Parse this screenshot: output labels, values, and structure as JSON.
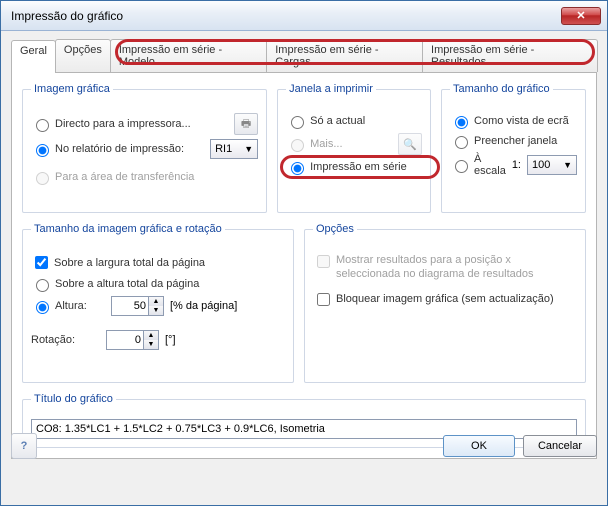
{
  "window": {
    "title": "Impressão do gráfico"
  },
  "tabs": {
    "geral": "Geral",
    "opcoes": "Opções",
    "serie_modelo": "Impressão em série - Modelo",
    "serie_cargas": "Impressão em série - Cargas",
    "serie_resultados": "Impressão em série - Resultados"
  },
  "group_imagem": {
    "legend": "Imagem gráfica",
    "directo": "Directo para a impressora...",
    "relatorio": "No relatório de impressão:",
    "relatorio_val": "RI1",
    "clipboard": "Para a área de transferência"
  },
  "group_janela": {
    "legend": "Janela a imprimir",
    "so_actual": "Só a actual",
    "mais": "Mais...",
    "serie": "Impressão em série"
  },
  "group_tamanho": {
    "legend": "Tamanho do gráfico",
    "como_vista": "Como vista de ecrã",
    "preencher": "Preencher janela",
    "escala": "À escala",
    "escala_prefix": "1:",
    "escala_val": "100"
  },
  "group_rotacao": {
    "legend": "Tamanho da imagem gráfica e rotação",
    "largura_total": "Sobre a largura total da página",
    "altura_total": "Sobre a altura total da página",
    "altura_label": "Altura:",
    "altura_val": "50",
    "altura_unit": "[% da página]",
    "rotacao_label": "Rotação:",
    "rotacao_val": "0",
    "rotacao_unit": "[°]"
  },
  "group_opcoes": {
    "legend": "Opções",
    "mostrar": "Mostrar resultados para a posição x seleccionada no diagrama de resultados",
    "bloquear": "Bloquear imagem gráfica (sem actualização)"
  },
  "group_titulo": {
    "legend": "Título do gráfico",
    "value": "CO8: 1.35*LC1 + 1.5*LC2 + 0.75*LC3 + 0.9*LC6, Isometria"
  },
  "footer": {
    "ok": "OK",
    "cancel": "Cancelar"
  }
}
